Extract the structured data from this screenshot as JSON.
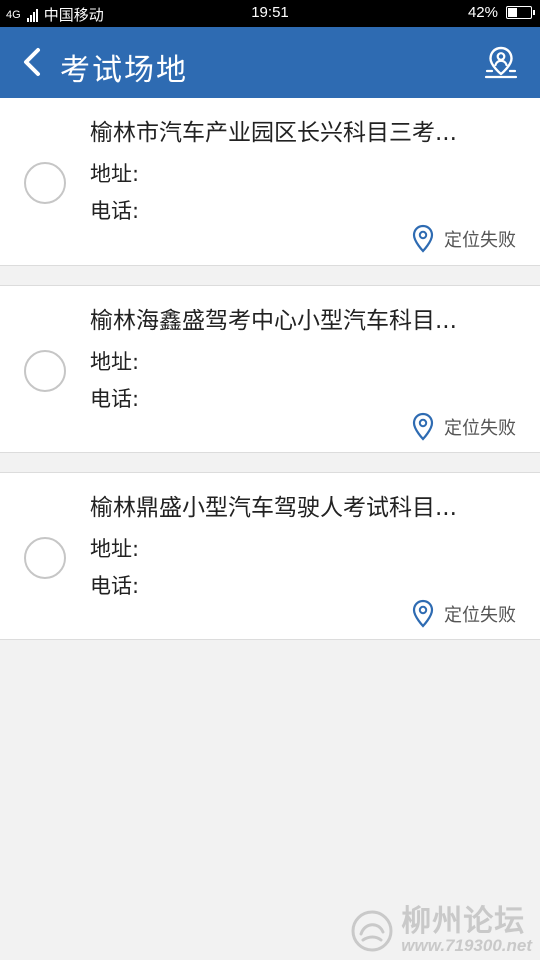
{
  "status_bar": {
    "network": "4G",
    "carrier": "中国移动",
    "time": "19:51",
    "battery_text": "42%",
    "battery_level": 0.42
  },
  "header": {
    "title": "考试场地",
    "back_icon": "chevron-left-icon",
    "map_icon": "map-user-pin-icon",
    "background_color": "#2e6bb2"
  },
  "venues": [
    {
      "name": "榆林市汽车产业园区长兴科目三考...",
      "address_label": "地址:",
      "phone_label": "电话:",
      "location_status": "定位失败"
    },
    {
      "name": "榆林海鑫盛驾考中心小型汽车科目...",
      "address_label": "地址:",
      "phone_label": "电话:",
      "location_status": "定位失败"
    },
    {
      "name": "榆林鼎盛小型汽车驾驶人考试科目...",
      "address_label": "地址:",
      "phone_label": "电话:",
      "location_status": "定位失败"
    }
  ],
  "watermark": {
    "text": "柳州论坛",
    "url": "www.719300.net"
  }
}
